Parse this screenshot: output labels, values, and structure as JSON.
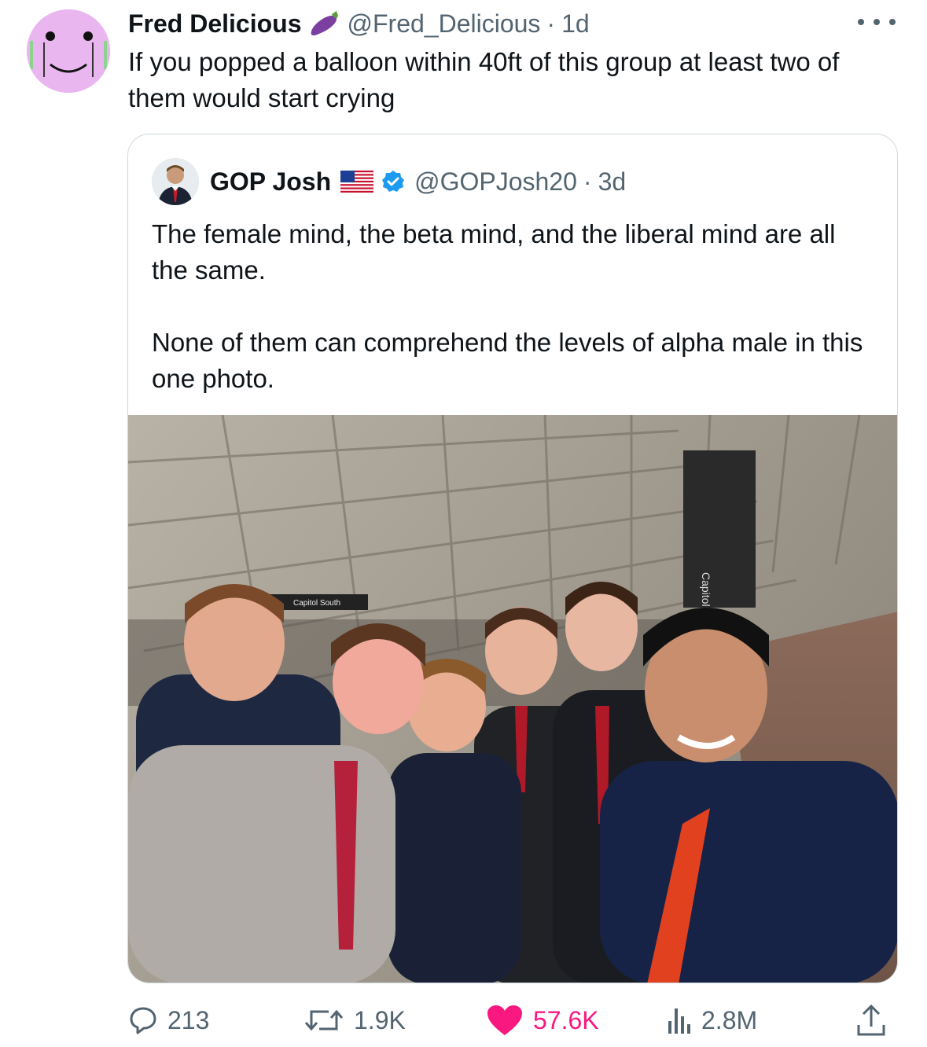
{
  "tweet": {
    "author_name": "Fred Delicious",
    "author_emoji": "eggplant-icon",
    "handle": "@Fred_Delicious",
    "sep": "·",
    "time": "1d",
    "text": "If you popped a balloon within 40ft of this group at least two of them would start crying"
  },
  "quoted_tweet": {
    "author_name": "GOP Josh",
    "flag": "us-flag-icon",
    "verified": "verified-badge-icon",
    "handle": "@GOPJosh20",
    "sep": "·",
    "time": "3d",
    "paragraphs": [
      "The female mind, the beta mind, and the liberal mind are all the same.",
      "None of them can comprehend the levels of alpha male in this one photo."
    ],
    "photo": {
      "sign_text": "Capitol South",
      "pillar_text": "Capitol"
    }
  },
  "actions": {
    "replies": "213",
    "retweets": "1.9K",
    "likes": "57.6K",
    "views": "2.8M"
  },
  "colors": {
    "like": "#f91880",
    "muted": "#536471",
    "verified": "#1d9bf0",
    "avatar_bg": "#e9b6ef"
  }
}
